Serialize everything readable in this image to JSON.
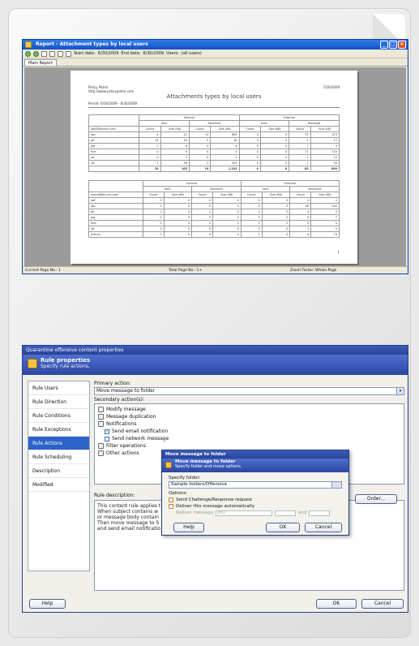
{
  "report_window": {
    "title": "Report - Attachment types by local users",
    "toolbar": {
      "start_label": "Start date:",
      "start_value": "6/30/2009",
      "end_label": "End date:",
      "end_value": "6/30/2009",
      "users_label": "Users:",
      "users_value": "(all users)"
    },
    "tab": "Main Report",
    "status": {
      "current_page": "Current Page No.: 1",
      "total_pages": "Total Page No.: 1+",
      "zoom": "Zoom Factor: Whole Page"
    },
    "report": {
      "company": "Policy Patrol",
      "url": "http://www.policypatrol.com",
      "date": "7/20/2009",
      "title": "Attachments types by local users",
      "period": "Period: 6/30/2009 - 6/30/2009",
      "group_headers": [
        "Internal",
        "External"
      ],
      "sub_headers": [
        "Sent",
        "Received",
        "Sent",
        "Received"
      ],
      "col_headers": [
        "Count",
        "Size (KB)",
        "Count",
        "Size (KB)",
        "Count",
        "Size (KB)",
        "Count",
        "Size (KB)"
      ],
      "user1": "john@dnumc.com",
      "rows1": [
        [
          "doc",
          "4",
          "21",
          "13",
          "863",
          "0",
          "0",
          "73",
          "373"
        ],
        [
          "gif",
          "14",
          "40",
          "0",
          "18",
          "0",
          "0",
          "1",
          "17"
        ],
        [
          "jpg",
          "1",
          "6",
          "4",
          "6",
          "0",
          "0",
          "1",
          "4"
        ],
        [
          "htm",
          "0",
          "0",
          "0",
          "0",
          "0",
          "0",
          "11",
          "110"
        ],
        [
          "xls",
          "0",
          "0",
          "0",
          "0",
          "0",
          "0",
          "1",
          "15"
        ],
        [
          "xls",
          "1",
          "36",
          "2",
          "300",
          "0",
          "0",
          "1",
          "34"
        ]
      ],
      "total1": [
        "",
        "20",
        "103",
        "19",
        "1,103",
        "0",
        "0",
        "83",
        "800"
      ],
      "user2": "mandi@dnumc.com",
      "rows2": [
        [
          "pdf",
          "0",
          "0",
          "0",
          "0",
          "0",
          "0",
          "1",
          "2"
        ],
        [
          "doc",
          "0",
          "0",
          "0",
          "0",
          "0",
          "0",
          "49",
          "240"
        ],
        [
          "gif",
          "0",
          "0",
          "2",
          "0",
          "0",
          "0",
          "4",
          "0"
        ],
        [
          "jpg",
          "0",
          "0",
          "0",
          "0",
          "0",
          "0",
          "4",
          "7"
        ],
        [
          "htm",
          "0",
          "0",
          "0",
          "0",
          "0",
          "0",
          "0",
          "0"
        ],
        [
          "txt",
          "0",
          "0",
          "0",
          "0",
          "0",
          "0",
          "1",
          "0"
        ],
        [
          "(inline)",
          "0",
          "0",
          "0",
          "0",
          "0",
          "0",
          "0",
          "74"
        ]
      ],
      "page_no": "1"
    }
  },
  "rule_dialog": {
    "title": "Quarantine offensive content properties",
    "header_title": "Rule properties",
    "header_subtitle": "Specify rule actions.",
    "sidebar": [
      "Rule Users",
      "Rule Direction",
      "Rule Conditions",
      "Rule Exceptions",
      "Rule Actions",
      "Rule Scheduling",
      "Description",
      "Modified"
    ],
    "active_item": "Rule Actions",
    "primary_label": "Primary action:",
    "primary_value": "Move message to folder",
    "secondary_label": "Secondary action(s):",
    "secondary": [
      {
        "label": "Modify message",
        "indent": false,
        "type": "icon"
      },
      {
        "label": "Message duplication",
        "indent": false,
        "type": "icon"
      },
      {
        "label": "Notifications",
        "indent": false,
        "type": "icon"
      },
      {
        "label": "Send email notification",
        "indent": true,
        "type": "checked"
      },
      {
        "label": "Send network message",
        "indent": true,
        "type": "unchecked"
      },
      {
        "label": "Filter operations",
        "indent": false,
        "type": "icon"
      },
      {
        "label": "Other actions",
        "indent": false,
        "type": "icon"
      }
    ],
    "order_button": "Order...",
    "desc_label": "Rule description:",
    "desc_lines": [
      "This content rule applies t",
      "When subject contains w",
      "or message body contain",
      "Then move message to S",
      "and send email notificatio"
    ],
    "help_button": "Help",
    "ok_button": "OK",
    "cancel_button": "Cancel"
  },
  "move_dialog": {
    "title": "Move message to folder",
    "header_title": "Move message to folder",
    "header_subtitle": "Specify folder and move options.",
    "folder_label": "Specify folder:",
    "folder_value": "Sample folders/Offensive",
    "options_label": "Options:",
    "opt1": "Send Challenge/Response request",
    "opt2": "Deliver this message automatically",
    "deliver_label": "Deliver message",
    "deliver_mode": "after",
    "and_label": "and",
    "help_button": "Help",
    "ok_button": "OK",
    "cancel_button": "Cancel"
  }
}
